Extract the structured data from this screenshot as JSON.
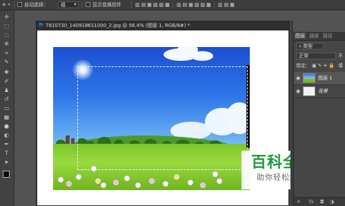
{
  "options_bar": {
    "move_icon": "move-tool-icon",
    "auto_select_label": "自动选择：",
    "auto_select_value": "组",
    "transform_controls_label": "显示变换控件"
  },
  "document": {
    "title": "7810730_140918611000_2.jpg @ 56.4% (图层 1, RGB/8#) *",
    "ps_badge": "Ps"
  },
  "watermark": {
    "big": "百科全说",
    "small": "助你轻松解决"
  },
  "layers_panel": {
    "tabs": [
      "图层",
      "通道",
      "路径"
    ],
    "filter_type": "类型",
    "blend_mode": "正常",
    "opacity_label": "不",
    "lock_label": "锁定：",
    "fill_label": "填",
    "layers": [
      {
        "name": "图层 1",
        "selected": true
      },
      {
        "name": "背景",
        "selected": false
      }
    ],
    "bottom_icons": [
      "link-icon",
      "fx-icon"
    ],
    "bottom_fx": "fx"
  },
  "colors": {
    "app_bg": "#535353",
    "panel_bg": "#464646",
    "watermark_green": "#1d9c3c"
  }
}
